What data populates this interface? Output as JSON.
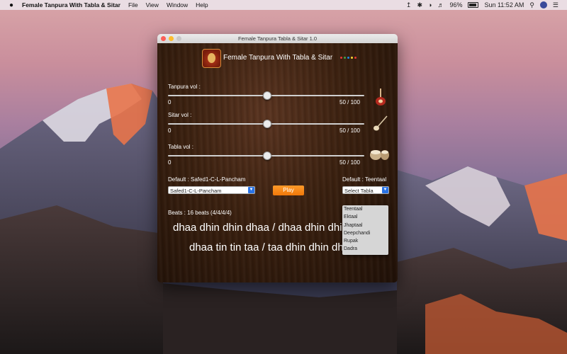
{
  "menubar": {
    "app_name": "Female Tanpura With Tabla & Sitar",
    "menus": [
      "File",
      "View",
      "Window",
      "Help"
    ],
    "battery_percent": "96%",
    "clock": "Sun 11:52 AM"
  },
  "window": {
    "title": "Female Tanpura Tabla & Sitar 1.0",
    "header_title": "Female Tanpura With Tabla & Sitar",
    "header_dot_colors": [
      "#e53935",
      "#43a047",
      "#1e88e5",
      "#fdd835",
      "#e53935"
    ]
  },
  "tanpura": {
    "label": "Tanpura vol :",
    "min": "0",
    "value_text": "50 / 100",
    "value": 50
  },
  "sitar": {
    "label": "Sitar  vol :",
    "min": "0",
    "value_text": "50 / 100",
    "value": 50
  },
  "tabla": {
    "label": "Tabla vol :",
    "min": "0",
    "value_text": "50 / 100",
    "value": 50
  },
  "scale": {
    "default_label": "Default : Safed1-C-L-Pancham",
    "selected": "Safed1-C-L-Pancham"
  },
  "play_label": "Play",
  "taal": {
    "default_label": "Default : Teentaal",
    "selected": "Select Tabla",
    "options": [
      "Teentaal",
      "Ektaal",
      "Jhaptaal",
      "Deepchandi",
      "Rupak",
      "Dadra"
    ]
  },
  "beats_label": "Beats : 16 beats (4/4/4/4)",
  "bol_line1": "dhaa dhin dhin dhaa / dhaa dhin dhin dhaa",
  "bol_line2": "dhaa tin tin taa / taa dhin dhin dhaa"
}
